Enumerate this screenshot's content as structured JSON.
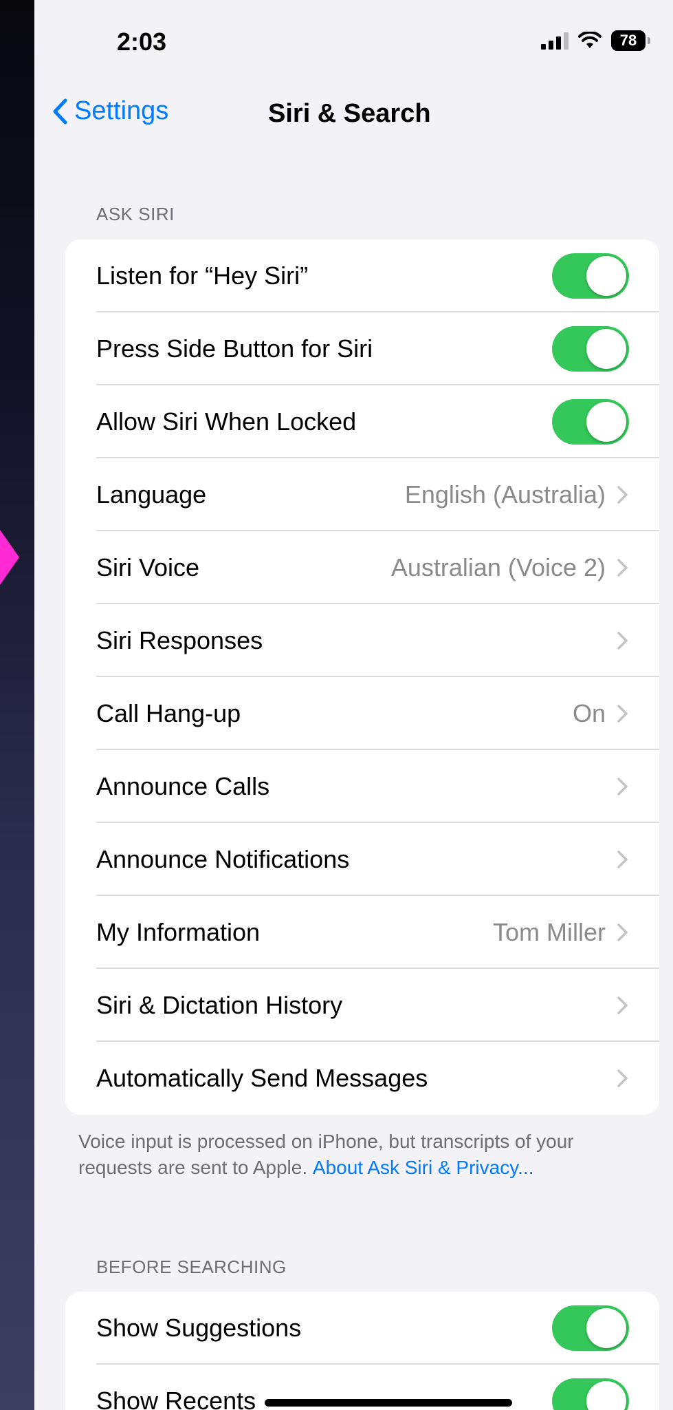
{
  "status_bar": {
    "time": "2:03",
    "battery_level": "78",
    "signal_bars_active": 3,
    "signal_bars_total": 4
  },
  "nav": {
    "back_label": "Settings",
    "title": "Siri & Search"
  },
  "ask_siri": {
    "header": "ASK SIRI",
    "rows": [
      {
        "label": "Listen for “Hey Siri”",
        "type": "toggle",
        "on": true
      },
      {
        "label": "Press Side Button for Siri",
        "type": "toggle",
        "on": true
      },
      {
        "label": "Allow Siri When Locked",
        "type": "toggle",
        "on": true
      },
      {
        "label": "Language",
        "value": "English (Australia)",
        "type": "link"
      },
      {
        "label": "Siri Voice",
        "value": "Australian (Voice 2)",
        "type": "link"
      },
      {
        "label": "Siri Responses",
        "value": "",
        "type": "link"
      },
      {
        "label": "Call Hang-up",
        "value": "On",
        "type": "link"
      },
      {
        "label": "Announce Calls",
        "value": "",
        "type": "link"
      },
      {
        "label": "Announce Notifications",
        "value": "",
        "type": "link"
      },
      {
        "label": "My Information",
        "value": "Tom Miller",
        "type": "link"
      },
      {
        "label": "Siri & Dictation History",
        "value": "",
        "type": "link"
      },
      {
        "label": "Automatically Send Messages",
        "value": "",
        "type": "link"
      }
    ],
    "footer_text": "Voice input is processed on iPhone, but transcripts of your requests are sent to Apple. ",
    "footer_link": "About Ask Siri & Privacy..."
  },
  "before_searching": {
    "header": "BEFORE SEARCHING",
    "rows": [
      {
        "label": "Show Suggestions",
        "type": "toggle",
        "on": true
      },
      {
        "label": "Show Recents",
        "type": "toggle",
        "on": true
      }
    ]
  },
  "colors": {
    "accent": "#007aff",
    "toggle_on": "#34c759",
    "annotation_arrow": "#ff2ad4"
  },
  "icons": {
    "back": "chevron-left-icon",
    "disclosure": "chevron-right-icon",
    "wifi": "wifi-icon",
    "signal": "cellular-signal-icon",
    "battery": "battery-icon"
  }
}
